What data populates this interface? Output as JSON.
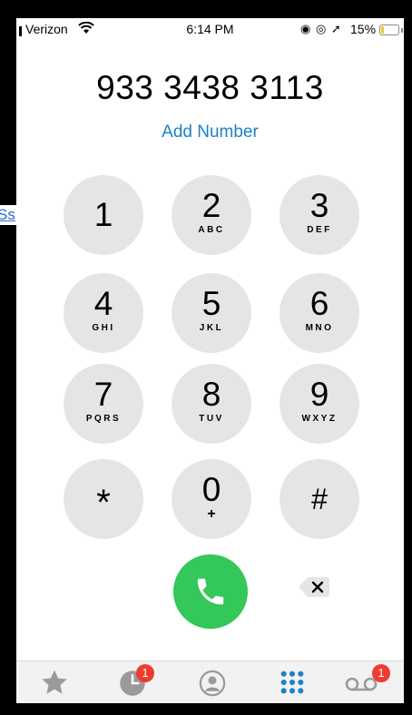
{
  "background_link": {
    "text": "Ss"
  },
  "status_bar": {
    "carrier": "Verizon",
    "time": "6:14 PM",
    "status_icons": "◉ ◎ ➚",
    "battery_percent": "15%",
    "battery_level": 0.15
  },
  "dialer": {
    "number": "933 3438 3113",
    "add_number_label": "Add Number"
  },
  "keypad": {
    "keys": [
      {
        "digit": "1",
        "letters": ""
      },
      {
        "digit": "2",
        "letters": "ABC"
      },
      {
        "digit": "3",
        "letters": "DEF"
      },
      {
        "digit": "4",
        "letters": "GHI"
      },
      {
        "digit": "5",
        "letters": "JKL"
      },
      {
        "digit": "6",
        "letters": "MNO"
      },
      {
        "digit": "7",
        "letters": "PQRS"
      },
      {
        "digit": "8",
        "letters": "TUV"
      },
      {
        "digit": "9",
        "letters": "WXYZ"
      },
      {
        "digit": "*",
        "letters": ""
      },
      {
        "digit": "0",
        "letters": "+"
      },
      {
        "digit": "#",
        "letters": ""
      }
    ]
  },
  "tab_bar": {
    "tabs": [
      {
        "icon": "star-icon",
        "badge": ""
      },
      {
        "icon": "clock-icon",
        "badge": "1"
      },
      {
        "icon": "person-icon",
        "badge": ""
      },
      {
        "icon": "keypad-icon",
        "badge": "",
        "active": true
      },
      {
        "icon": "voicemail-icon",
        "badge": "1"
      }
    ],
    "active_color": "#1a82c8",
    "inactive_color": "#9a9a9a"
  },
  "colors": {
    "call_green": "#34c759",
    "key_gray": "#e5e5e5",
    "link_blue": "#1a82c8",
    "badge_red": "#f03b30"
  }
}
